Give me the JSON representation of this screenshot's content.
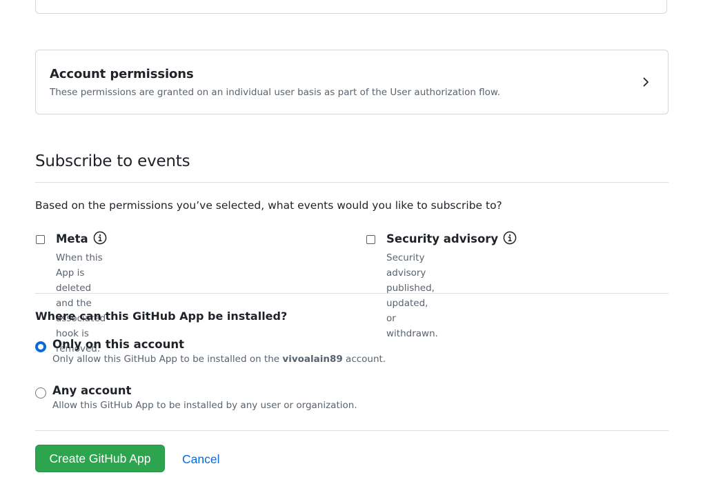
{
  "account_permissions": {
    "title": "Account permissions",
    "description": "These permissions are granted on an individual user basis as part of the User authorization flow."
  },
  "subscribe": {
    "title": "Subscribe to events",
    "question": "Based on the permissions you’ve selected, what events would you like to subscribe to?",
    "events": [
      {
        "label": "Meta",
        "description_line1": "When this App is deleted and the associated hook is",
        "description_line2": "removed.",
        "checked": false
      },
      {
        "label": "Security advisory",
        "description_line1": "Security advisory published, updated, or withdrawn.",
        "checked": false
      }
    ]
  },
  "install": {
    "title": "Where can this GitHub App be installed?",
    "options": [
      {
        "label": "Only on this account",
        "description_prefix": "Only allow this GitHub App to be installed on the ",
        "description_account": "vivoalain89",
        "description_suffix": " account.",
        "checked": true
      },
      {
        "label": "Any account",
        "description": "Allow this GitHub App to be installed by any user or organization.",
        "checked": false
      }
    ]
  },
  "actions": {
    "create_label": "Create GitHub App",
    "cancel_label": "Cancel"
  },
  "colors": {
    "primary_button": "#2da44e",
    "link": "#0969da",
    "radio_checked": "#0969da",
    "border": "#d0d7de",
    "muted_text": "#59636e"
  },
  "icons": {
    "expand": "chevron-right-icon",
    "info": "info-icon"
  }
}
